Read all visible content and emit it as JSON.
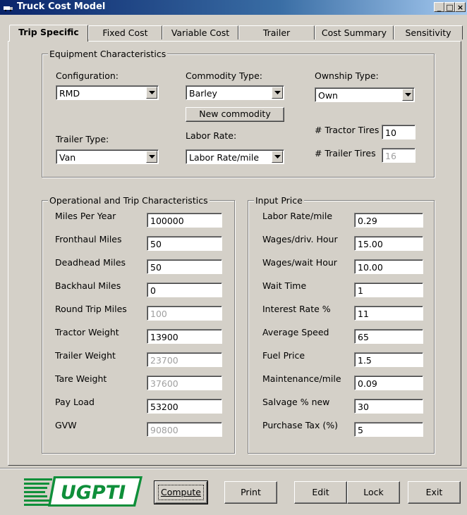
{
  "window": {
    "title": "Truck Cost Model",
    "minimize": "_",
    "maximize": "□",
    "close": "×"
  },
  "tabs": [
    "Trip Specific",
    "Fixed Cost",
    "Variable Cost",
    "Trailer",
    "Cost Summary",
    "Sensitivity"
  ],
  "equipment": {
    "title": "Equipment Characteristics",
    "configuration_label": "Configuration:",
    "configuration_value": "RMD",
    "commodity_label": "Commodity Type:",
    "commodity_value": "Barley",
    "new_commodity": "New commodity",
    "ownership_label": "Ownship Type:",
    "ownership_value": "Own",
    "trailer_type_label": "Trailer Type:",
    "trailer_type_value": "Van",
    "labor_rate_label": "Labor Rate:",
    "labor_rate_value": "Labor Rate/mile",
    "tractor_tires_label": "# Tractor Tires",
    "tractor_tires_value": "10",
    "trailer_tires_label": "# Trailer Tires",
    "trailer_tires_value": "16"
  },
  "operational": {
    "title": "Operational and Trip Characteristics",
    "rows": [
      {
        "label": "Miles Per Year",
        "value": "100000",
        "disabled": false
      },
      {
        "label": "Fronthaul Miles",
        "value": "50",
        "disabled": false
      },
      {
        "label": "Deadhead Miles",
        "value": "50",
        "disabled": false
      },
      {
        "label": "Backhaul Miles",
        "value": "0",
        "disabled": false
      },
      {
        "label": "Round Trip Miles",
        "value": "100",
        "disabled": true
      },
      {
        "label": "Tractor Weight",
        "value": "13900",
        "disabled": false
      },
      {
        "label": "Trailer Weight",
        "value": "23700",
        "disabled": true
      },
      {
        "label": "Tare Weight",
        "value": "37600",
        "disabled": true
      },
      {
        "label": "Pay Load",
        "value": "53200",
        "disabled": false
      },
      {
        "label": "GVW",
        "value": "90800",
        "disabled": true
      }
    ]
  },
  "input_price": {
    "title": "Input Price",
    "rows": [
      {
        "label": "Labor Rate/mile",
        "value": "0.29"
      },
      {
        "label": "Wages/driv. Hour",
        "value": "15.00"
      },
      {
        "label": "Wages/wait Hour",
        "value": "10.00"
      },
      {
        "label": "Wait Time",
        "value": "1"
      },
      {
        "label": "Interest Rate %",
        "value": "11"
      },
      {
        "label": "Average Speed",
        "value": "65"
      },
      {
        "label": "Fuel Price",
        "value": "1.5"
      },
      {
        "label": "Maintenance/mile",
        "value": "0.09"
      },
      {
        "label": "Salvage % new",
        "value": "30"
      },
      {
        "label": "Purchase Tax (%)",
        "value": "5"
      }
    ]
  },
  "logo_text": "UGPTI",
  "buttons": {
    "compute": "Compute",
    "print": "Print",
    "edit": "Edit",
    "lock": "Lock",
    "exit": "Exit"
  }
}
